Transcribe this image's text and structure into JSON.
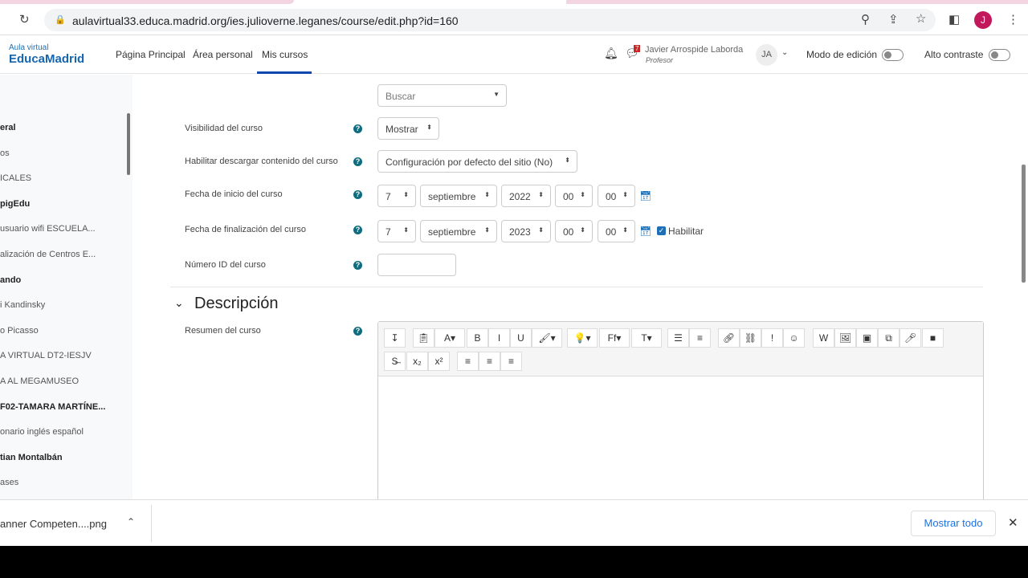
{
  "browser": {
    "url": "aulavirtual33.educa.madrid.org/ies.julioverne.leganes/course/edit.php?id=160",
    "profile_initial": "J"
  },
  "nav": {
    "logo_top": "Aula virtual",
    "logo_main": "EducaMadrid",
    "links": [
      "Página Principal",
      "Área personal",
      "Mis cursos"
    ],
    "active": "Mis cursos",
    "messages_badge": "7",
    "user_name": "Javier Arrospide Laborda",
    "user_role": "Profesor",
    "user_initials": "JA",
    "edit_mode": "Modo de edición",
    "high_contrast": "Alto contraste"
  },
  "sidebar": {
    "items": [
      {
        "t": "eral",
        "b": true
      },
      {
        "t": "os",
        "b": false
      },
      {
        "t": "ICALES",
        "b": false
      },
      {
        "t": "pigEdu",
        "b": true
      },
      {
        "t": "usuario wifi ESCUELA...",
        "b": false
      },
      {
        "t": "alización de Centros E...",
        "b": false
      },
      {
        "t": "ando",
        "b": true
      },
      {
        "t": "i Kandinsky",
        "b": false
      },
      {
        "t": "o Picasso",
        "b": false
      },
      {
        "t": "A VIRTUAL DT2-IESJV",
        "b": false
      },
      {
        "t": "A AL MEGAMUSEO",
        "b": false
      },
      {
        "t": "F02-TAMARA MARTÍNE...",
        "b": true
      },
      {
        "t": "onario inglés español",
        "b": false
      },
      {
        "t": "tian Montalbán",
        "b": true
      },
      {
        "t": "ases",
        "b": false
      }
    ]
  },
  "form": {
    "search_select": "Buscar",
    "visibility": {
      "label": "Visibilidad del curso",
      "value": "Mostrar"
    },
    "download": {
      "label": "Habilitar descargar contenido del curso",
      "value": "Configuración por defecto del sitio (No)"
    },
    "start": {
      "label": "Fecha de inicio del curso",
      "day": "7",
      "month": "septiembre",
      "year": "2022",
      "hour": "00",
      "minute": "00"
    },
    "end": {
      "label": "Fecha de finalización del curso",
      "day": "7",
      "month": "septiembre",
      "year": "2023",
      "hour": "00",
      "minute": "00",
      "enable": "Habilitar",
      "enabled": true
    },
    "idnumber": {
      "label": "Número ID del curso",
      "value": ""
    },
    "section": "Descripción",
    "summary_label": "Resumen del curso"
  },
  "downloads": {
    "file": "anner Competen....png",
    "show_all": "Mostrar todo"
  }
}
